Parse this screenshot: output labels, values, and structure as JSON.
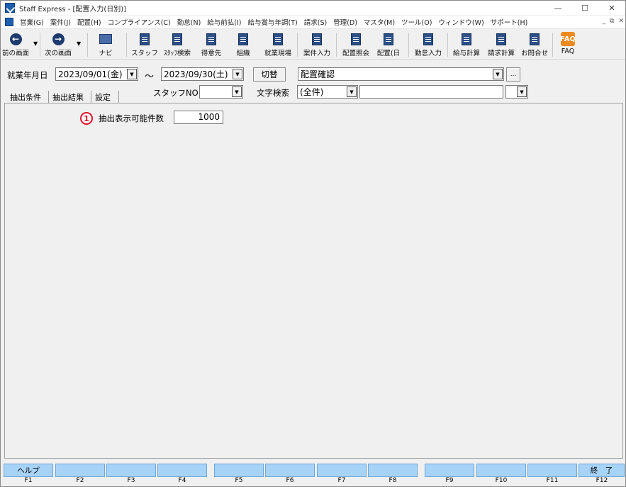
{
  "window": {
    "title": "Staff Express - [配置入力(日別)]",
    "controls": [
      "—",
      "☐",
      "✕"
    ]
  },
  "menu": {
    "items": [
      "営業(G)",
      "案件(J)",
      "配置(H)",
      "コンプライアンス(C)",
      "勤怠(N)",
      "給与前払(I)",
      "給与賞与年調(T)",
      "請求(S)",
      "管理(D)",
      "マスタ(M)",
      "ツール(O)",
      "ウィンドウ(W)",
      "サポート(H)"
    ],
    "mdi_controls": [
      "_",
      "⧉",
      "✕"
    ]
  },
  "toolbar": {
    "prev": "前の画面",
    "next": "次の画面",
    "navi": "ナビ",
    "staff": "スタッフ",
    "staff_search": "ｽﾀｯﾌ検索",
    "client": "得意先",
    "org": "組織",
    "site": "就業現場",
    "case_input": "案件入力",
    "assign_inquiry": "配置照会",
    "assign_day": "配置(日",
    "attendance": "勤怠入力",
    "payroll": "給与計算",
    "billing": "請求計算",
    "contact": "お問合せ",
    "faq": "FAQ",
    "faq_icon_text": "FAQ"
  },
  "filters": {
    "work_date_label": "就業年月日",
    "date_from": "2023/09/01(金)",
    "tilde": "〜",
    "date_to": "2023/09/30(土)",
    "switch_button": "切替",
    "view_select": "配置確認",
    "ellipsis_button": "...",
    "staff_no_label": "スタッフNO",
    "staff_no_value": "",
    "text_search_label": "文字検索",
    "text_search_scope": "(全件)",
    "text_search_value": "",
    "extra_select": ""
  },
  "tabs": [
    "抽出条件",
    "抽出結果",
    "設定"
  ],
  "settings": {
    "marker": "1",
    "max_results_label": "抽出表示可能件数",
    "max_results_value": "1000"
  },
  "fkeys": [
    {
      "label": "ヘルプ",
      "key": "F1"
    },
    {
      "label": "",
      "key": "F2"
    },
    {
      "label": "",
      "key": "F3"
    },
    {
      "label": "",
      "key": "F4"
    },
    {
      "label": "",
      "key": "F5"
    },
    {
      "label": "",
      "key": "F6"
    },
    {
      "label": "",
      "key": "F7"
    },
    {
      "label": "",
      "key": "F8"
    },
    {
      "label": "",
      "key": "F9"
    },
    {
      "label": "",
      "key": "F10"
    },
    {
      "label": "",
      "key": "F11"
    },
    {
      "label": "終　了",
      "key": "F12"
    }
  ],
  "colors": {
    "fkey_bg": "#a7d3f7",
    "marker": "#e0102a",
    "icon_blue": "#1d3a6e",
    "faq_orange": "#f08a1a"
  }
}
